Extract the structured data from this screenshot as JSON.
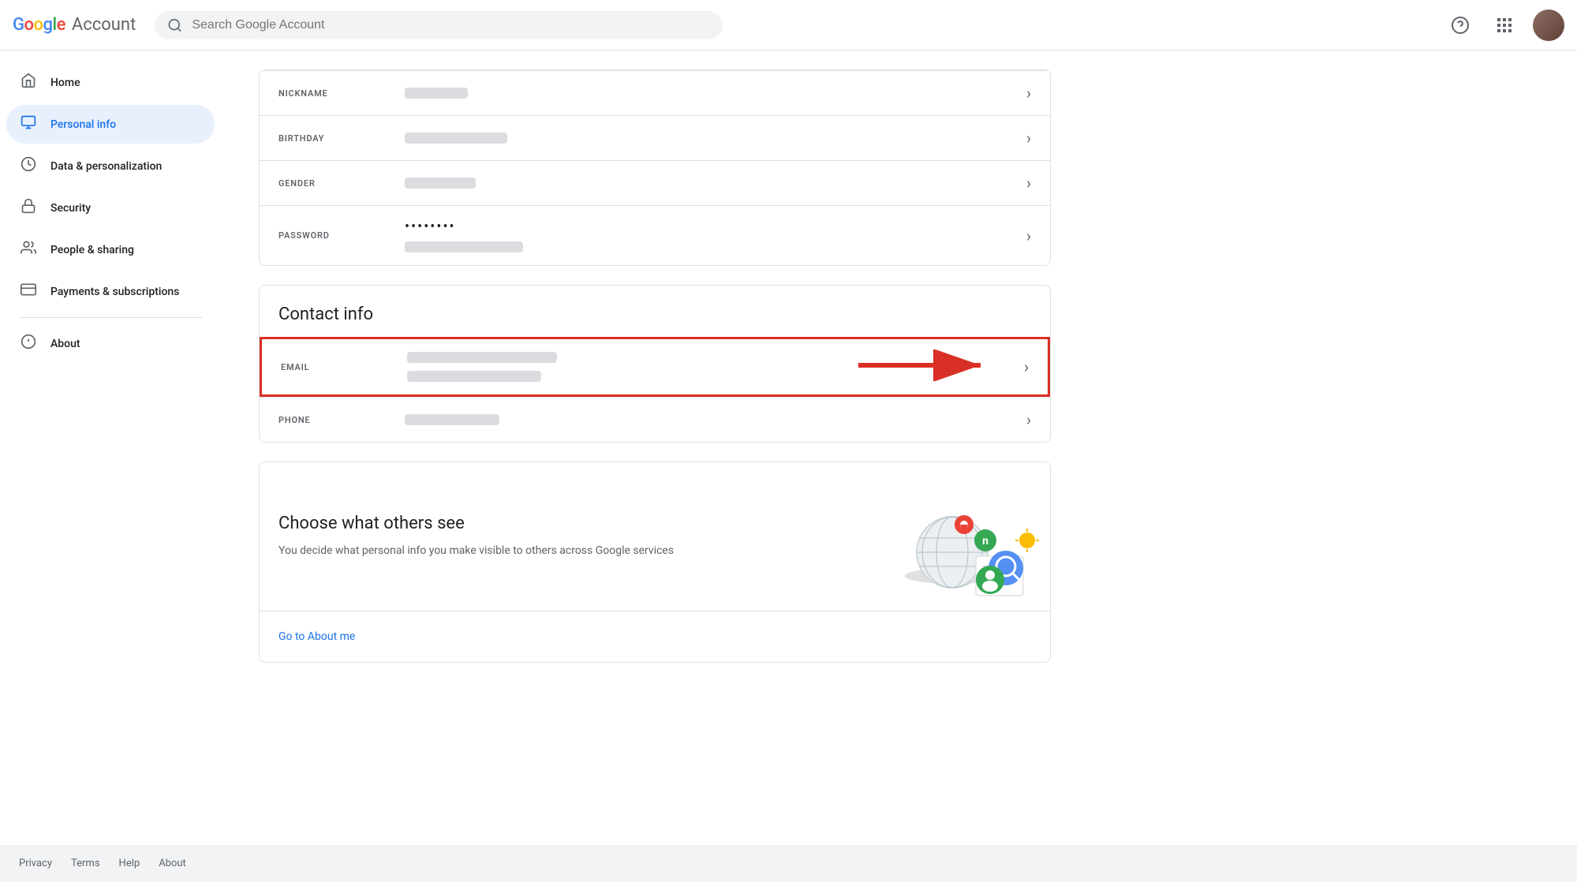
{
  "header": {
    "logo_google": "Google",
    "logo_account": "Account",
    "search_placeholder": "Search Google Account"
  },
  "sidebar": {
    "items": [
      {
        "id": "home",
        "label": "Home",
        "icon": "home"
      },
      {
        "id": "personal-info",
        "label": "Personal info",
        "icon": "person",
        "active": true
      },
      {
        "id": "data-personalization",
        "label": "Data & personalization",
        "icon": "toggle"
      },
      {
        "id": "security",
        "label": "Security",
        "icon": "lock"
      },
      {
        "id": "people-sharing",
        "label": "People & sharing",
        "icon": "people"
      },
      {
        "id": "payments",
        "label": "Payments & subscriptions",
        "icon": "card"
      },
      {
        "id": "about",
        "label": "About",
        "icon": "info"
      }
    ]
  },
  "main": {
    "sections": {
      "basic_info": {
        "rows": [
          {
            "id": "nickname",
            "label": "NICKNAME",
            "value1_width": "80px",
            "value1": ""
          },
          {
            "id": "birthday",
            "label": "BIRTHDAY",
            "value1_width": "120px",
            "value1": ""
          },
          {
            "id": "gender",
            "label": "GENDER",
            "value1_width": "90px",
            "value1": ""
          },
          {
            "id": "password",
            "label": "PASSWORD",
            "dots": "••••••••",
            "value1_width": "140px",
            "value1": ""
          }
        ]
      },
      "contact_info": {
        "title": "Contact info",
        "rows": [
          {
            "id": "email",
            "label": "EMAIL",
            "value1_width": "180px",
            "value2_width": "160px",
            "highlighted": true
          },
          {
            "id": "phone",
            "label": "PHONE",
            "value1_width": "110px",
            "highlighted": false
          }
        ]
      },
      "choose_others": {
        "title": "Choose what others see",
        "description": "You decide what personal info you make visible to others across Google services",
        "link": "Go to About me"
      }
    }
  },
  "footer": {
    "links": [
      "Privacy",
      "Terms",
      "Help",
      "About"
    ]
  }
}
